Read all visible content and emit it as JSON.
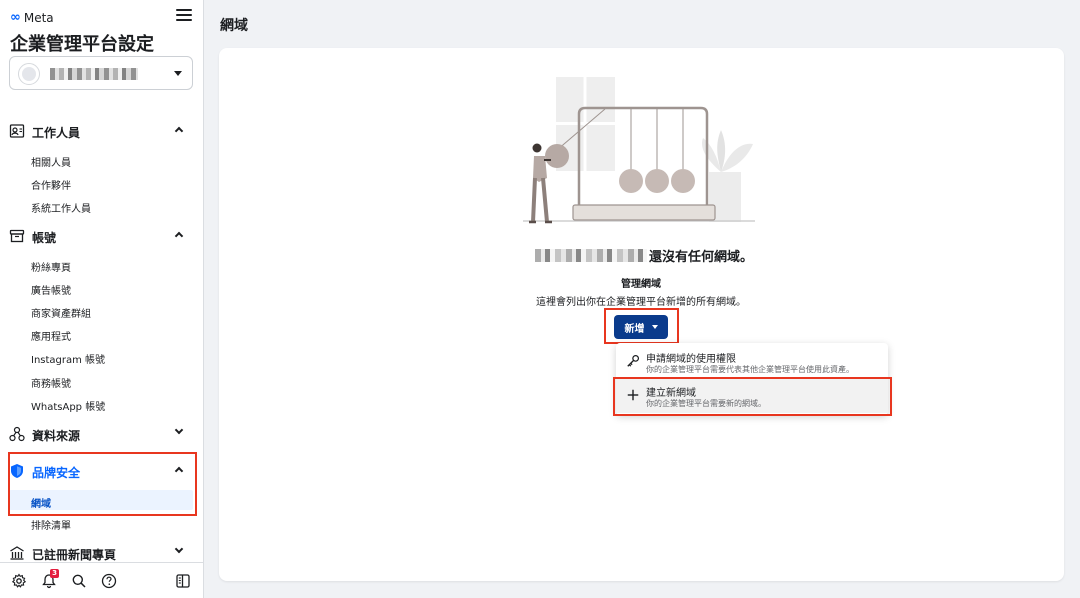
{
  "brand": {
    "logo_symbol": "∞",
    "name": "Meta"
  },
  "app_title": "企業管理平台設定",
  "sidebar": {
    "sections": [
      {
        "label": "工作人員",
        "icon": "person-badge-icon",
        "expanded": true,
        "items": [
          "相關人員",
          "合作夥伴",
          "系統工作人員"
        ]
      },
      {
        "label": "帳號",
        "icon": "archive-box-icon",
        "expanded": true,
        "items": [
          "粉絲專頁",
          "廣告帳號",
          "商家資產群組",
          "應用程式",
          "Instagram 帳號",
          "商務帳號",
          "WhatsApp 帳號"
        ]
      },
      {
        "label": "資料來源",
        "icon": "data-nodes-icon",
        "expanded": false,
        "items": []
      },
      {
        "label": "品牌安全",
        "icon": "shield-icon",
        "expanded": true,
        "items": [
          "網域",
          "排除清單"
        ],
        "active_item": "網域"
      },
      {
        "label": "已註冊新聞專頁",
        "icon": "building-icon",
        "expanded": false,
        "items": []
      }
    ]
  },
  "footer": {
    "notification_count": "3"
  },
  "main": {
    "page_title": "網域",
    "empty_state": {
      "heading_suffix": "還沒有任何網域。",
      "section_title": "管理網域",
      "description": "這裡會列出你在企業管理平台新增的所有網域。"
    },
    "add_button": "新增",
    "dropdown": [
      {
        "title": "申請網域的使用權限",
        "desc": "你的企業管理平台需要代表其他企業管理平台使用此資產。",
        "icon": "key-icon"
      },
      {
        "title": "建立新網域",
        "desc": "你的企業管理平台需要新的網域。",
        "icon": "plus-icon"
      }
    ]
  },
  "colors": {
    "accent": "#0866ff",
    "button": "#0a3b8c",
    "highlight_box": "#e8361f",
    "active_bg": "#ebf3ff"
  }
}
